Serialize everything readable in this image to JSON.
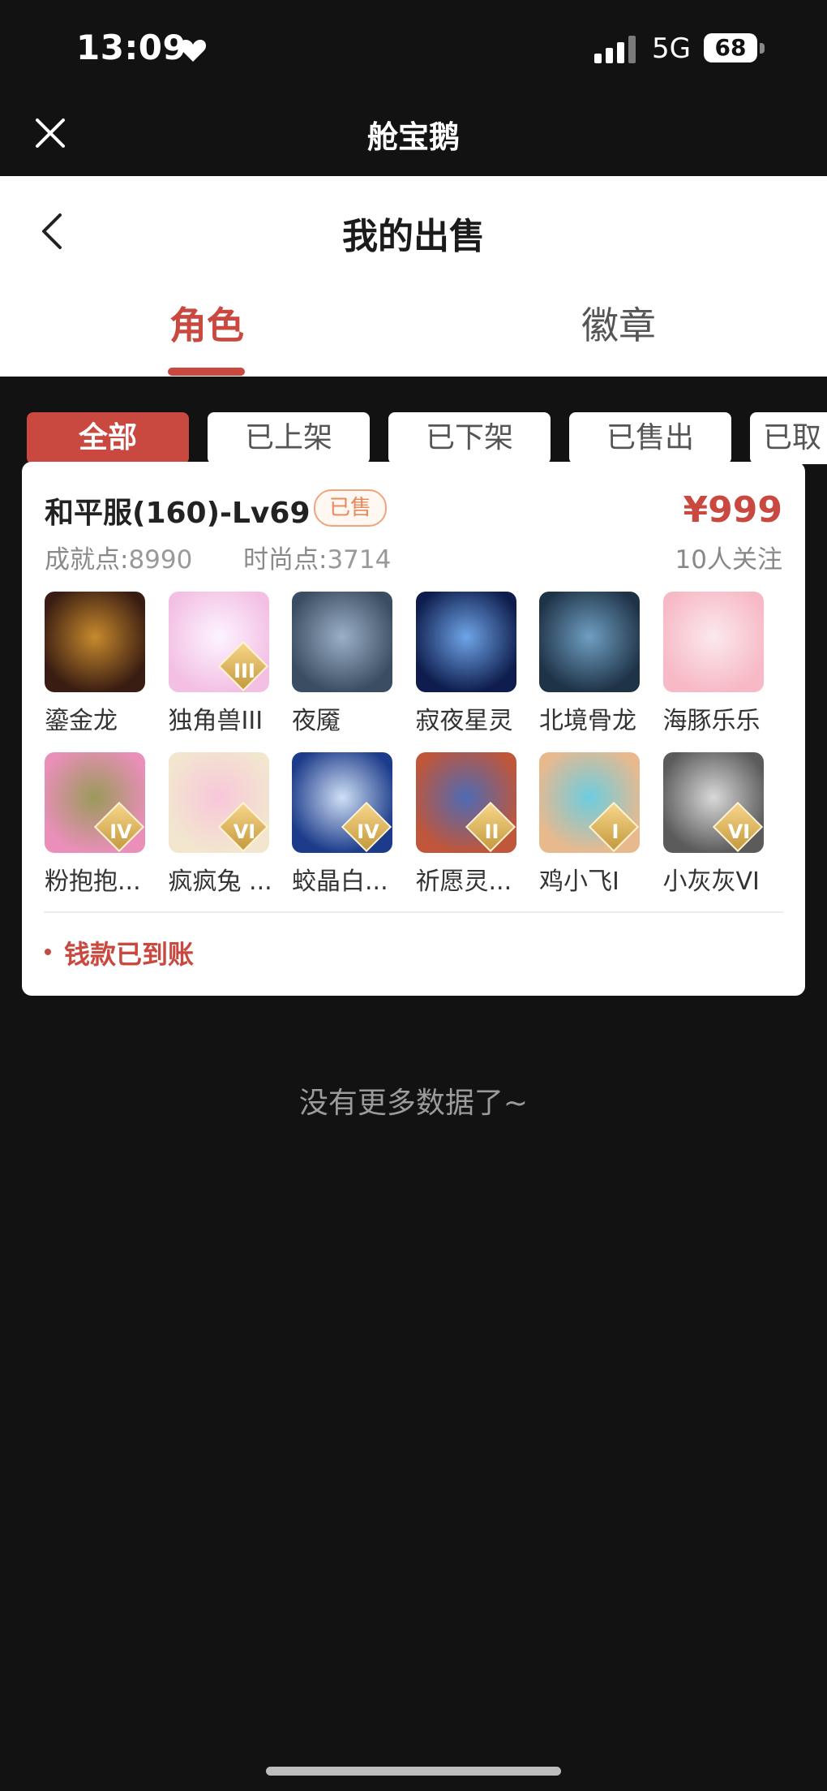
{
  "status_bar": {
    "time": "13:09",
    "network": "5G",
    "battery": "68"
  },
  "app_header": {
    "title": "舱宝鹅"
  },
  "page": {
    "title": "我的出售"
  },
  "tabs": [
    {
      "label": "角色",
      "active": true
    },
    {
      "label": "徽章",
      "active": false
    }
  ],
  "filters": [
    {
      "label": "全部",
      "active": true
    },
    {
      "label": "已上架"
    },
    {
      "label": "已下架"
    },
    {
      "label": "已售出"
    },
    {
      "label": "已取消"
    }
  ],
  "listing": {
    "server": "和平服(160)-Lv69",
    "status_badge": "已售",
    "price": "¥999",
    "achievement_label": "成就点:",
    "achievement_value": "8990",
    "fashion_label": "时尚点:",
    "fashion_value": "3714",
    "followers": "10人关注",
    "pets": [
      {
        "name": "鎏金龙",
        "colors": [
          "#3a1d12",
          "#c78a2d"
        ],
        "rank": ""
      },
      {
        "name": "独角兽III",
        "colors": [
          "#f3c0e4",
          "#fdf4ff"
        ],
        "rank": "III"
      },
      {
        "name": "夜魇",
        "colors": [
          "#3b4d62",
          "#9bb0c7"
        ],
        "rank": ""
      },
      {
        "name": "寂夜星灵",
        "colors": [
          "#0e1d4d",
          "#6fa5e8"
        ],
        "rank": ""
      },
      {
        "name": "北境骨龙",
        "colors": [
          "#1f3347",
          "#6f9fc2"
        ],
        "rank": ""
      },
      {
        "name": "海豚乐乐",
        "colors": [
          "#f7b9c5",
          "#fbe9ee"
        ],
        "rank": ""
      },
      {
        "name": "粉抱抱...",
        "colors": [
          "#e98fb9",
          "#9a9a5a"
        ],
        "rank": "IV"
      },
      {
        "name": "疯疯兔 ...",
        "colors": [
          "#f2e6cf",
          "#f8c7da"
        ],
        "rank": "VI"
      },
      {
        "name": "蛟晶白...",
        "colors": [
          "#1c3b8a",
          "#cfe0f5"
        ],
        "rank": "IV"
      },
      {
        "name": "祈愿灵...",
        "colors": [
          "#c0563a",
          "#4e6bb5"
        ],
        "rank": "II"
      },
      {
        "name": "鸡小飞I",
        "colors": [
          "#e9b98e",
          "#6ccde0"
        ],
        "rank": "I"
      },
      {
        "name": "小灰灰VI",
        "colors": [
          "#5b5b5b",
          "#d9d9d9"
        ],
        "rank": "VI"
      }
    ],
    "payment_status": "钱款已到账"
  },
  "footer_text": "没有更多数据了~",
  "icons": {
    "close": "close-icon",
    "back": "chevron-left-icon",
    "heart": "heart-icon",
    "signal": "signal-icon",
    "battery": "battery-icon"
  },
  "colors": {
    "accent": "#c9483f",
    "background": "#121213",
    "sold_badge": "#e9885a"
  }
}
